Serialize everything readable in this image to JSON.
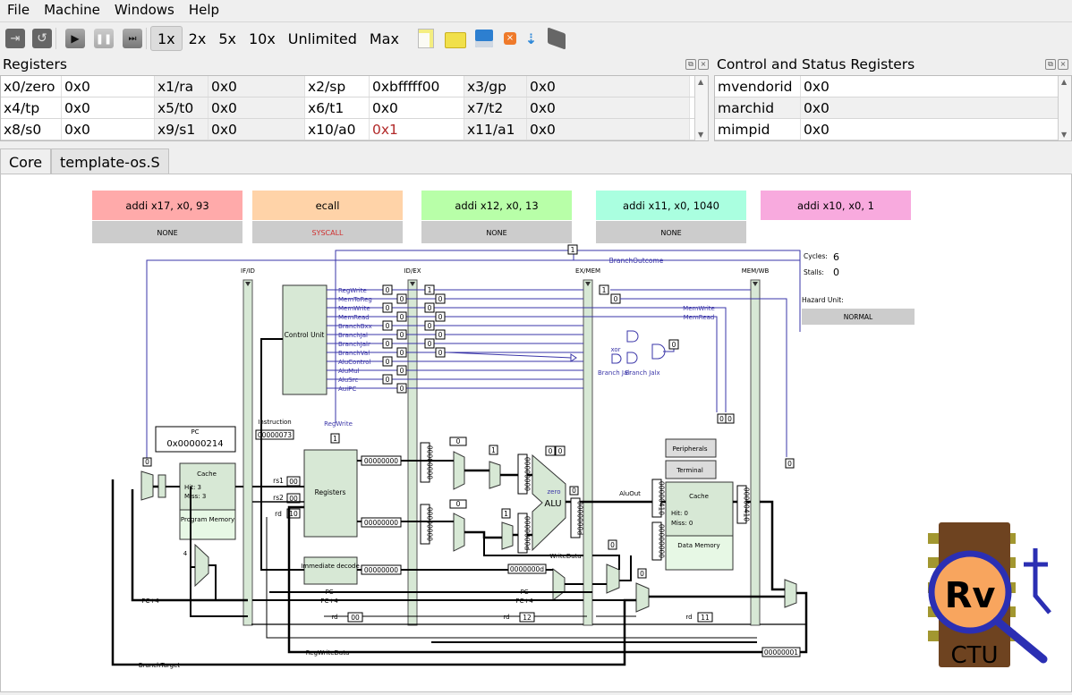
{
  "menu": [
    "File",
    "Machine",
    "Windows",
    "Help"
  ],
  "toolbar": {
    "icons": [
      "compile-icon",
      "reset-icon",
      "run-icon",
      "pause-icon",
      "step-icon"
    ],
    "speeds": [
      "1x",
      "2x",
      "5x",
      "10x",
      "Unlimited",
      "Max"
    ],
    "active_speed": "1x",
    "file_icons": [
      "new-file-icon",
      "open-file-icon",
      "save-file-icon",
      "close-file-icon",
      "load-icon",
      "build-icon"
    ]
  },
  "registers": {
    "title": "Registers",
    "rows": [
      [
        [
          "x0/zero",
          "0x0"
        ],
        [
          "x1/ra",
          "0x0"
        ],
        [
          "x2/sp",
          "0xbfffff00"
        ],
        [
          "x3/gp",
          "0x0"
        ]
      ],
      [
        [
          "x4/tp",
          "0x0"
        ],
        [
          "x5/t0",
          "0x0"
        ],
        [
          "x6/t1",
          "0x0"
        ],
        [
          "x7/t2",
          "0x0"
        ]
      ],
      [
        [
          "x8/s0",
          "0x0"
        ],
        [
          "x9/s1",
          "0x0"
        ],
        [
          "x10/a0",
          "0x1"
        ],
        [
          "x11/a1",
          "0x0"
        ]
      ]
    ],
    "highlight_color": "#b22a2a"
  },
  "csr": {
    "title": "Control and Status Registers",
    "rows": [
      [
        "mvendorid",
        "0x0"
      ],
      [
        "marchid",
        "0x0"
      ],
      [
        "mimpid",
        "0x0"
      ]
    ]
  },
  "tabs": [
    "Core",
    "template-os.S"
  ],
  "pipeline": {
    "stages": [
      {
        "instr": "addi x17, x0, 93",
        "exc": "NONE",
        "color": "#ffaaaa"
      },
      {
        "instr": "ecall",
        "exc": "SYSCALL",
        "color": "#ffd3a8",
        "exc_color": "#d03030"
      },
      {
        "instr": "addi x12, x0, 13",
        "exc": "NONE",
        "color": "#b8ffa8"
      },
      {
        "instr": "addi x11, x0, 1040",
        "exc": "NONE",
        "color": "#aaffe0"
      },
      {
        "instr": "addi x10, x0, 1",
        "exc": null,
        "color": "#f8aade"
      }
    ],
    "cycles_label": "Cycles:",
    "cycles": "6",
    "stalls_label": "Stalls:",
    "stalls": "0",
    "hazard_label": "Hazard Unit:",
    "hazard": "NORMAL",
    "latches": [
      "IF/ID",
      "ID/EX",
      "EX/MEM",
      "MEM/WB"
    ],
    "pc_label": "PC",
    "pc": "0x00000214",
    "program_cache": {
      "title": "Cache",
      "hit": "Hit:  3",
      "miss": "Miss:  3",
      "mem": "Program Memory"
    },
    "data_cache": {
      "title": "Cache",
      "hit": "Hit:  0",
      "miss": "Miss:  0",
      "mem": "Data Memory"
    },
    "instruction_label": "Instruction",
    "instruction": "00000073",
    "control_unit": "Control Unit",
    "registers_block": "Registers",
    "imm_decode": "Immediate decode",
    "alu": "ALU",
    "zero": "zero",
    "peripherals": "Peripherals",
    "terminal": "Terminal",
    "signals": [
      "RegWrite",
      "MemToReg",
      "MemWrite",
      "MemRead",
      "BranchBxx",
      "BranchJal",
      "BranchJalr",
      "BranchVal",
      "AluControl",
      "AluMul",
      "AluSrc",
      "AuiPC"
    ],
    "signal_vals_id": [
      "0",
      "0",
      "0",
      "0",
      "0",
      "0",
      "0",
      "0",
      "0",
      "0",
      "0",
      "0"
    ],
    "signal_vals_ex": [
      "1",
      "0",
      "0",
      "0",
      "0",
      "0",
      "0",
      "0"
    ],
    "rs1": "00",
    "rs2": "00",
    "rd": "10",
    "rs1_label": "rs1",
    "rs2_label": "rs2",
    "rd_label": "rd",
    "regwrite_label": "RegWrite",
    "regwrite_val": "1",
    "reg_out1": "00000000",
    "reg_out2": "00000000",
    "imm_out": "00000000",
    "ex_val1": "00000000",
    "ex_val2": "00000000",
    "alu_a": "00000000",
    "alu_b": "0000000d",
    "alu_out": "0000000d",
    "branch_target_val": "0000000d",
    "aluout_label": "AluOut",
    "writedata_label": "WriteData",
    "mem_addr": "00000410",
    "mem_wdata": "00000000",
    "mem_out": "00000410",
    "wb_val": "00000001",
    "pc_label2": "PC",
    "pc4_label": "PC+4",
    "regwritedata": "RegWriteData",
    "branchtarget": "BranchTarget",
    "branchoutcome": "BranchOutcome",
    "memwrite": "MemWrite",
    "memread": "MemRead",
    "xor": "xor",
    "branch_jalr": "Branch Jalr",
    "branch_jalx": "Branch Jalx",
    "rd_ex": "00",
    "rd_mem": "12",
    "rd_wb": "11",
    "four": "4"
  },
  "logo": {
    "text": "Rv",
    "sub": "CTU"
  }
}
